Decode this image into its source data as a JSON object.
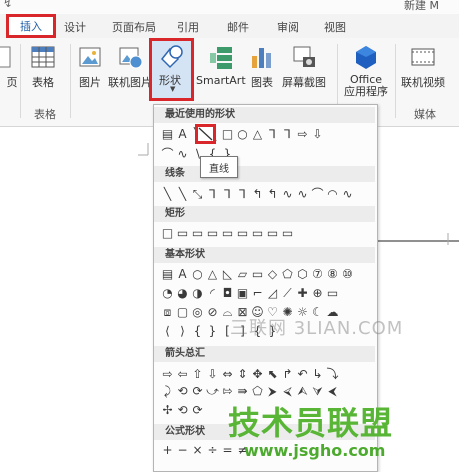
{
  "window": {
    "title": "新建 M",
    "qa_glyph": "↯"
  },
  "tabs": [
    {
      "label": "插入"
    },
    {
      "label": "设计"
    },
    {
      "label": "页面布局"
    },
    {
      "label": "引用"
    },
    {
      "label": "邮件"
    },
    {
      "label": "审阅"
    },
    {
      "label": "视图"
    }
  ],
  "ribbon": {
    "page_partial": "页",
    "table": "表格",
    "picture": "图片",
    "online_picture": "联机图片",
    "shapes": "形状",
    "smartart": "SmartArt",
    "chart": "图表",
    "screenshot": "屏幕截图",
    "office_apps_line1": "Office",
    "office_apps_line2": "应用程序",
    "online_video": "联机视频",
    "group_table": "表格",
    "group_media": "媒体"
  },
  "dropdown": {
    "recent": "最近使用的形状",
    "lines": "线条",
    "rect": "矩形",
    "basic": "基本形状",
    "arrows": "箭头总汇",
    "formula": "公式形状",
    "tooltip": "直线",
    "recent_row": [
      "▤",
      "A",
      "╲",
      "╲",
      "□",
      "○",
      "△",
      "⅂",
      "⅂",
      "⇨",
      "⇩"
    ],
    "recent_row2": [
      "⌒",
      "∿",
      "∖",
      "{",
      "}"
    ],
    "lines_row": [
      "╲",
      "╲",
      "⤡",
      "⅂",
      "⅂",
      "⅂",
      "↰",
      "↰",
      "∿",
      "∿",
      "⌒",
      "◠",
      "∿"
    ],
    "rect_row": [
      "□",
      "▭",
      "▭",
      "▭",
      "▭",
      "▭",
      "▭",
      "▭",
      "▭"
    ],
    "basic_row1": [
      "▤",
      "A",
      "○",
      "△",
      "◺",
      "▱",
      "▭",
      "◇",
      "⬠",
      "⬡",
      "⑦",
      "⑧",
      "⑩"
    ],
    "basic_row2": [
      "◔",
      "◕",
      "◑",
      "◜",
      "◘",
      "▣",
      "⌐",
      "◿",
      "⟋",
      "✚",
      "⊕",
      "▭"
    ],
    "basic_row3": [
      "⧈",
      "▢",
      "◎",
      "⊘",
      "⌓",
      "⊠",
      "☺",
      "♡",
      "✺",
      "☼",
      "☾",
      "☁"
    ],
    "basic_row4": [
      "⟨",
      "⟩",
      "{",
      "}",
      "[",
      "]",
      "{",
      "}"
    ],
    "arrows_row1": [
      "⇨",
      "⇦",
      "⇧",
      "⇩",
      "⇔",
      "⇕",
      "✥",
      "⬉",
      "↱",
      "↶",
      "↳",
      "⤵"
    ],
    "arrows_row2": [
      "⤸",
      "⟲",
      "⟳",
      "⤻",
      "⇰",
      "⇛",
      "⬠",
      "⮞",
      "⮘",
      "⮙",
      "⮛",
      "⮜"
    ],
    "arrows_row3": [
      "✢",
      "⟲",
      "⟳"
    ],
    "formula_row": [
      "+",
      "−",
      "×",
      "÷",
      "=",
      "≠"
    ]
  },
  "watermarks": {
    "site1": "三联网 3LIAN.COM",
    "site2": "技术员联盟",
    "site3": "www.jsgho.com"
  }
}
